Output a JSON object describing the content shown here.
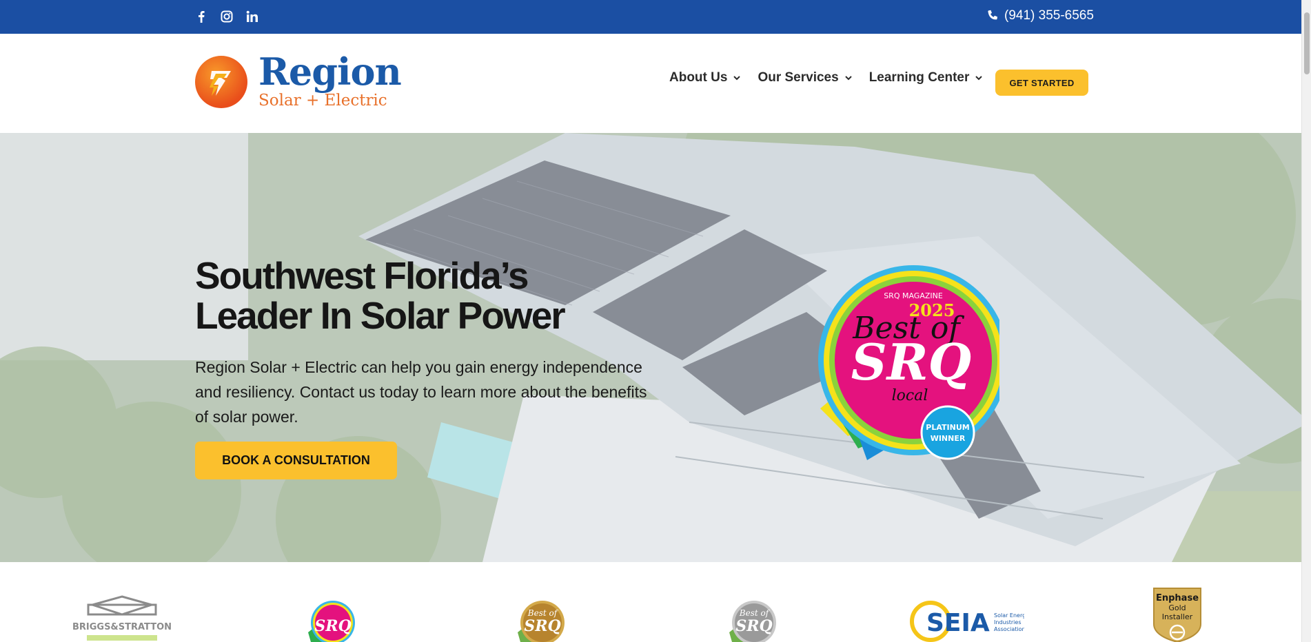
{
  "topbar": {
    "social_icons": [
      "facebook-icon",
      "instagram-icon",
      "linkedin-icon"
    ],
    "phone": "(941) 355-6565",
    "bg_color": "#1b4fa3"
  },
  "header": {
    "logo_main": "Region",
    "logo_sub": "Solar + Electric",
    "nav": [
      {
        "label": "About Us"
      },
      {
        "label": "Our Services"
      },
      {
        "label": "Learning Center"
      }
    ],
    "cta_label": "GET STARTED",
    "accent_color": "#fbc02d"
  },
  "hero": {
    "title": "Southwest Florida’s Leader In Solar Power",
    "text": "Region Solar + Electric can help you gain energy independence and resiliency. Contact us today to learn more about the benefits of solar power.",
    "cta_label": "BOOK A CONSULTATION",
    "badge": {
      "ribbon": "SRQ MAGAZINE",
      "year": "2025",
      "line1": "Best of",
      "line2": "SRQ",
      "line3": "local",
      "seal": "PLATINUM WINNER"
    }
  },
  "partners": {
    "briggs": "BRIGGS&STRATTON",
    "srq_small": "SRQ",
    "seia": "SEIA",
    "seia_sub": "Solar Energy Industries Association®",
    "enphase": "Enphase",
    "enphase_tier": "Gold",
    "enphase_role": "Installer"
  }
}
